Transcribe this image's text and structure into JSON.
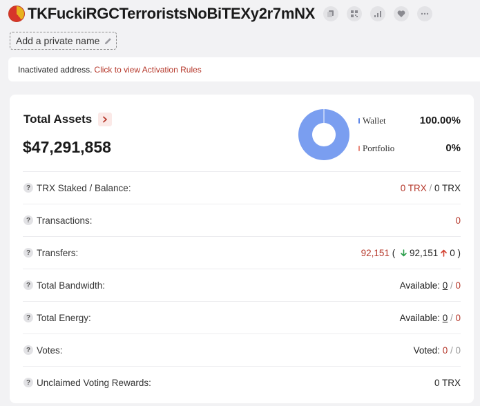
{
  "header": {
    "address": "TKFuckiRGCTerroristsNoBiTEXy2r7mNX",
    "actions": [
      "copy-icon",
      "qrcode-icon",
      "chart-icon",
      "heart-icon",
      "more-icon"
    ]
  },
  "private_name": {
    "label": "Add a private name"
  },
  "notice": {
    "text": "Inactivated address.",
    "link": "Click to view Activation Rules"
  },
  "assets": {
    "title": "Total Assets",
    "value": "$47,291,858",
    "chart_data": {
      "type": "pie",
      "labels": [
        "Wallet",
        "Portfolio"
      ],
      "values": [
        100,
        0
      ],
      "colors": [
        "#7a9ef0",
        "#e8877a"
      ]
    },
    "legend": [
      {
        "label": "Wallet",
        "value": "100.00%",
        "color": "#5b85e8"
      },
      {
        "label": "Portfolio",
        "value": "0%",
        "color": "#e8877a"
      }
    ]
  },
  "rows": {
    "staked": {
      "label": "TRX Staked / Balance:",
      "staked": "0 TRX",
      "sep": " / ",
      "balance": "0 TRX"
    },
    "transactions": {
      "label": "Transactions:",
      "value": "0"
    },
    "transfers": {
      "label": "Transfers:",
      "total": "92,151",
      "open": " ( ",
      "in": "92,151",
      "out": "0",
      "close": " )"
    },
    "bandwidth": {
      "label": "Total Bandwidth:",
      "prefix": "Available: ",
      "available": "0",
      "sep": " / ",
      "total": "0"
    },
    "energy": {
      "label": "Total Energy:",
      "prefix": "Available: ",
      "available": "0",
      "sep": " / ",
      "total": "0"
    },
    "votes": {
      "label": "Votes:",
      "prefix": "Voted: ",
      "voted": "0",
      "sep": " / ",
      "total": "0"
    },
    "rewards": {
      "label": "Unclaimed Voting Rewards:",
      "value": "0 TRX"
    }
  }
}
